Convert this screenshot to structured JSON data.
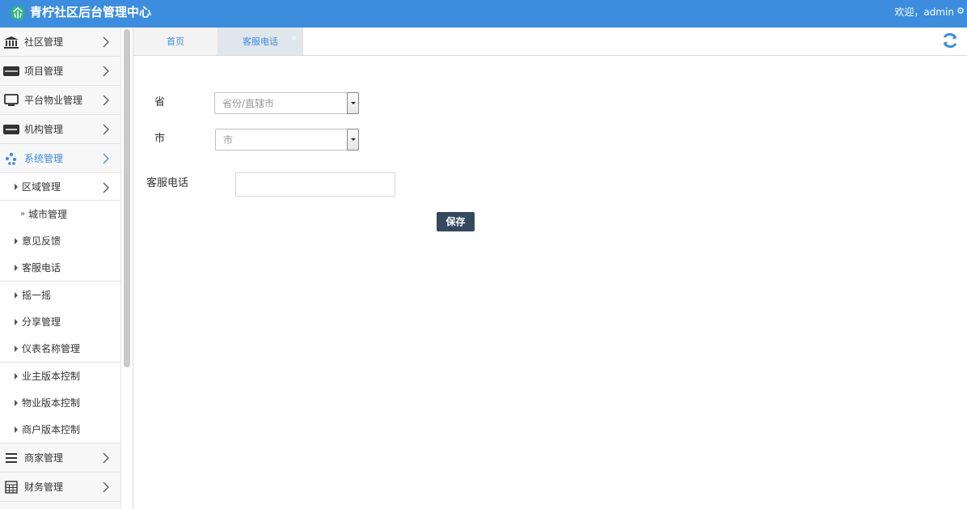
{
  "header": {
    "title": "青柠社区后台管理中心",
    "welcome": "欢迎，admin",
    "colors": {
      "bar": "#3c8dde"
    }
  },
  "sidebar": {
    "menus": [
      {
        "label": "社区管理",
        "icon": "bank-icon"
      },
      {
        "label": "项目管理",
        "icon": "discover-card-icon"
      },
      {
        "label": "平台物业管理",
        "icon": "monitor-icon"
      },
      {
        "label": "机构管理",
        "icon": "stripe-icon"
      },
      {
        "label": "系统管理",
        "icon": "yelp-icon"
      }
    ],
    "submenu": [
      {
        "label": "区域管理"
      },
      {
        "label": "城市管理"
      },
      {
        "label": "意见反馈"
      },
      {
        "label": "客服电话"
      },
      {
        "label": "摇一摇"
      },
      {
        "label": "分享管理"
      },
      {
        "label": "仪表名称管理"
      },
      {
        "label": "业主版本控制"
      },
      {
        "label": "物业版本控制"
      },
      {
        "label": "商户版本控制"
      }
    ],
    "bottom_menus": [
      {
        "label": "商家管理",
        "icon": "list-icon"
      },
      {
        "label": "财务管理",
        "icon": "calculator-icon"
      }
    ]
  },
  "tabs": [
    {
      "label": "首页"
    },
    {
      "label": "客服电话",
      "close": "×"
    }
  ],
  "form": {
    "province_label": "省",
    "province_placeholder": "省份/直辖市",
    "city_label": "市",
    "city_placeholder": "市",
    "phone_label": "客服电话",
    "phone_value": "",
    "save_label": "保存"
  }
}
